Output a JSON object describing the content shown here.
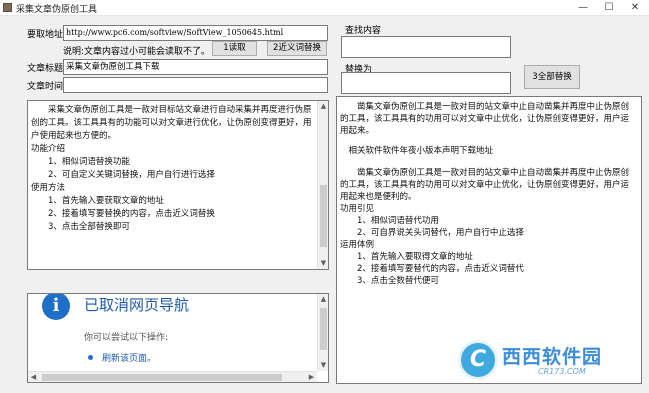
{
  "window": {
    "title": "采集文章伪原创工具"
  },
  "form": {
    "url_label": "要取地址",
    "url_value": "http://www.pc6.com/softview/SoftView_1050645.html",
    "note": "说明:文章内容过小可能会读取不了。",
    "read_button": "1读取",
    "replace_button": "2近义词替换",
    "title_label": "文章标题:",
    "title_value": "采集文章伪原创工具下载",
    "time_label": "文章时间:",
    "time_value": "",
    "find_label": "查找内容",
    "find_value": "",
    "replace_with_label": "替换为",
    "replace_with_value": "",
    "replace_all_button": "3全部替换"
  },
  "left_text": {
    "paragraphs": [
      "　　采集文章伪原创工具是一款对目标站文章进行自动采集并再度进行伪原创的工具。该工具具有的功能可以对文章进行优化，让伪原创变得更好，用户使用起来也方便的。",
      "功能介绍",
      "　　1、相似词语替换功能",
      "　　2、可自定义关键词替换，用户自行进行选择",
      "使用方法",
      "　　1、首先输入要获取文章的地址",
      "　　2、接着填写要替换的内容，点击近义词替换",
      "　　3、点击全部替换即可"
    ]
  },
  "browser_panel": {
    "title": "已取消网页导航",
    "hint": "你可以尝试以下操作:",
    "link": "刷新该页面。"
  },
  "right_text": {
    "paragraphs": [
      "　　凿集文章伪原创工具是一款对目的站文章中止自动凿集并再度中止伪原创的工具，该工具具有的功用可以对文章中止优化，让伪原创变得更好，用户运用起来。",
      "",
      "　相关软件软件年夜小版本声明下载地址",
      "",
      "　　凿集文章伪原创工具是一款对目的站文章中止自动凿集并再度中止伪原创的工具，该工具具有的功用可以对文章中止优化，让伪原创变得更好，用户运用起来也是便利的。",
      "功用引见",
      "　　1、相似词语替代功用",
      "　　2、可自界说关头词替代，用户自行中止选择",
      "运用体例",
      "　　1、首先输入要取得文章的地址",
      "　　2、接着填写要替代的内容，点击近义词替代",
      "　　3、点击全数替代便可"
    ]
  },
  "watermark": {
    "brand": "西西软件园",
    "sub": "CR173.COM",
    "logo_letter": "C"
  },
  "colors": {
    "link": "#1e5aa8",
    "info_icon": "#1e6fc8",
    "watermark": "#3d8ed8"
  }
}
